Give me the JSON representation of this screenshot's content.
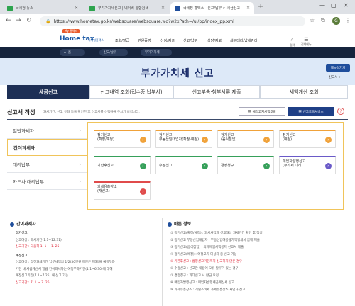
{
  "browser": {
    "tabs": [
      {
        "label": "국세청 뉴스",
        "color": "#2da44e"
      },
      {
        "label": "부가가치세신고 | 네이버 통합검색",
        "color": "#2da44e"
      },
      {
        "label": "국세청 홈택스 - 신고/납부 > 세금신고",
        "color": "#1f4e9c"
      }
    ],
    "new_tab": "+",
    "url": "https://www.hometax.go.kr/websquare/websquare.wq?w2xPath=/ui/pp/index_pp.xml"
  },
  "site": {
    "logo": "Home tax",
    "logo_badge": "My 홈택스",
    "logo_sub": "국세청홈택스",
    "gnb": [
      "조회/발급",
      "민원증명",
      "신청/제출",
      "신고/납부",
      "상담/제보",
      "세무대리/납세관리"
    ],
    "util": [
      "검색",
      "전체메뉴"
    ],
    "nav_pills": [
      "홈",
      "신고/납부",
      "부가가치세"
    ],
    "page_title": "부가가치세 신고",
    "side_button": "매뉴얼가기",
    "side_select": "신고서 ▾"
  },
  "tabs": [
    "세금신고",
    "신고내역 조회(접수증·납부서)",
    "신고부속·첨부서류 제출",
    "세액계산 조회"
  ],
  "section": {
    "title": "신고서 작성",
    "desc": "과세기간, 신고 유형 등을 확인한 후 신고서를 선택하여 주시기 바랍니다.",
    "btn_preview": "예정고지세액조회",
    "btn_help": "신고도움서비스",
    "btn_close": "?"
  },
  "left_menu": [
    {
      "label": "일반과세자",
      "active": false
    },
    {
      "label": "간이과세자",
      "active": true
    },
    {
      "label": "대리납부",
      "active": false
    },
    {
      "label": "카드사 대리납부",
      "active": false
    }
  ],
  "cards": [
    {
      "l1": "정기신고",
      "l2": "(확정/예정)",
      "color": "orange"
    },
    {
      "l1": "정기신고",
      "l2": "부동산임대업자(확정·예정)",
      "color": "orange"
    },
    {
      "l1": "정기신고",
      "l2": "(음식점업)",
      "color": "orange"
    },
    {
      "l1": "정기신고",
      "l2": "(예정)",
      "color": "orange"
    },
    {
      "l1": "기한후신고",
      "l2": "",
      "color": "green"
    },
    {
      "l1": "수정신고",
      "l2": "",
      "color": "green"
    },
    {
      "l1": "경정청구",
      "l2": "",
      "color": "green"
    },
    {
      "l1": "매입자발행신고",
      "l2": "(부가세 대리)",
      "color": "purple"
    },
    {
      "l1": "과세유흥장소",
      "l2": "(재신고)",
      "color": "red"
    }
  ],
  "info_left": {
    "title": "간이과세자",
    "lines": [
      "정기신고",
      "신고대상 : 과세기간(1.1~12.31)",
      "신고기간 : 다음해 1. 1 ~ 1. 25",
      "예정신고",
      "신고대상 : 직전과세기간 납부세액의 1/2(50만원 미만은 제외)을 예정부과",
      "기한 내 세금계산서 발급 간이과세자는 예정부과기간(1.1~6.30)에 대해",
      "예정신고기간(7.1~7.25) 내 신고 가능",
      "신고기간 : 7. 1 ~ 7. 25"
    ]
  },
  "info_right": {
    "title": "바른 정보",
    "lines": [
      "① 정기신고(확정/예정) : 과세사업자 신고대상 과세기간 확인 후 작성",
      "② 정기신고 부동산임대업자 : 부동산임대공급가액명세서 함께 제출",
      "③ 정기신고(음식점업) : 의제매입세액공제 신고서 제출",
      "④ 정기신고(예정) : 예정고지 대상자 중 신고 가능",
      "⑤ 기한후신고 : 법정신고기한까지 신고하지 않은 경우",
      "⑥ 수정신고 : 신고한 내용에 오류 탈루가 있는 경우",
      "⑦ 경정청구 : 과다신고 시 환급 요청",
      "⑧ 매입자발행신고 : 매입자발행세금계산서 신고",
      "⑨ 과세유흥장소 : 개별소비세 과세유흥장소 사업자 신고"
    ]
  },
  "colors": {
    "navy": "#1d2f55",
    "accent": "#f0c45a",
    "blue": "#1f4e9c"
  }
}
